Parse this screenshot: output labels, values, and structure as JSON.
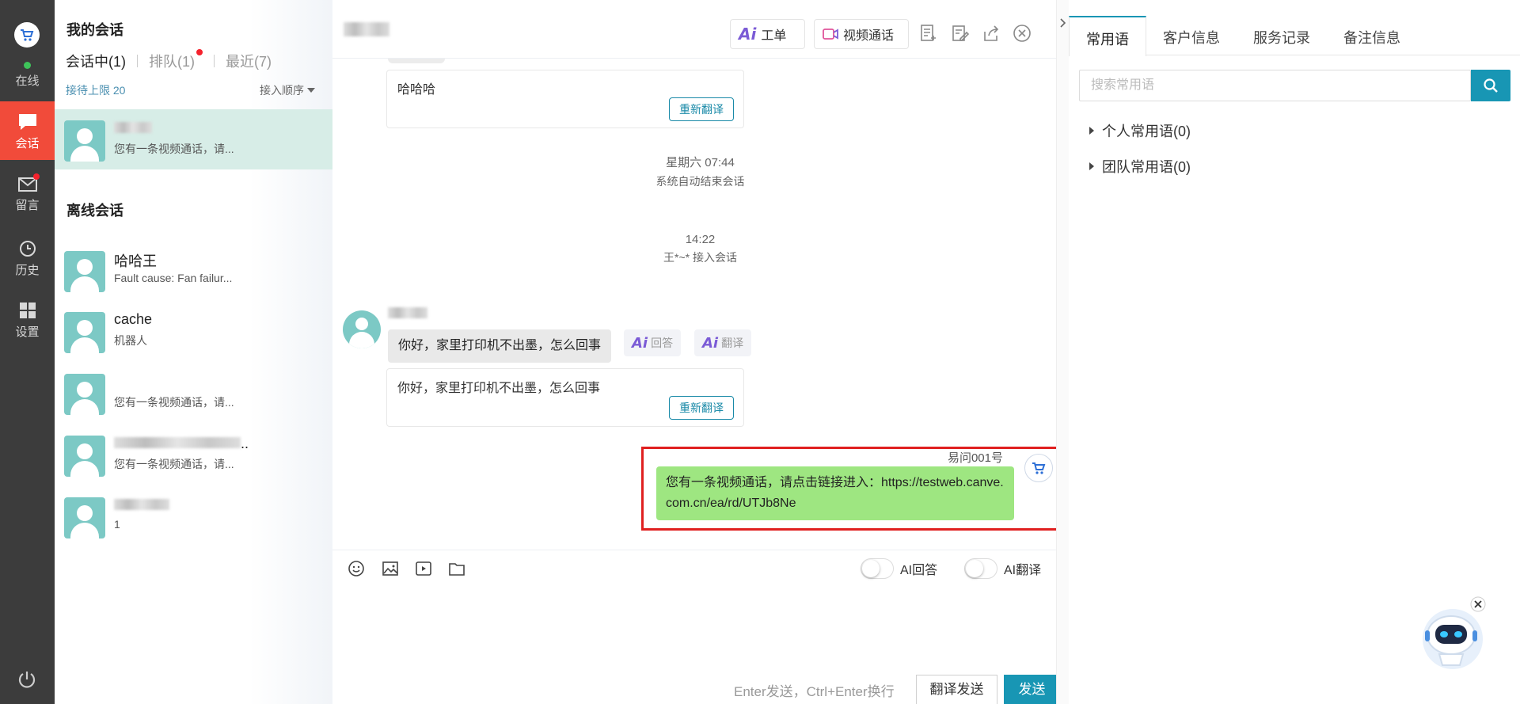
{
  "rail": {
    "status": "在线",
    "items": [
      {
        "label": "会话",
        "icon": "chat-icon"
      },
      {
        "label": "留言",
        "icon": "mail-icon"
      },
      {
        "label": "历史",
        "icon": "clock-icon"
      },
      {
        "label": "设置",
        "icon": "grid-icon"
      }
    ],
    "power_icon": "power-icon"
  },
  "sessions": {
    "title": "我的会话",
    "tabs": [
      {
        "label": "会话中(1)"
      },
      {
        "label": "排队(1)"
      },
      {
        "label": "最近(7)"
      }
    ],
    "limit": "接待上限 20",
    "order": "接入顺序",
    "active": [
      {
        "name": "",
        "preview": "您有一条视频通话，请..."
      }
    ],
    "offline_title": "离线会话",
    "offline": [
      {
        "name": "哈哈王",
        "preview": "Fault cause: Fan failur..."
      },
      {
        "name": "cache",
        "preview": "机器人"
      },
      {
        "name": "",
        "preview": "您有一条视频通话，请..."
      },
      {
        "name": "..",
        "preview": "您有一条视频通话，请..."
      },
      {
        "name": "",
        "preview": "1"
      }
    ]
  },
  "chat": {
    "header": {
      "ai_mark": "Ai",
      "ticket_label": "工单",
      "video_label": "视频通话"
    },
    "messages": {
      "translation_1": "哈哈哈",
      "retranslate": "重新翻译",
      "sys_1_time": "星期六 07:44",
      "sys_1_note": "系统自动结束会话",
      "sys_2_time": "14:22",
      "sys_2_note": "王*~* 接入会话",
      "customer_text": "你好，家里打印机不出墨，怎么回事",
      "ai_answer": "回答",
      "ai_translate": "翻译",
      "translation_2": "你好，家里打印机不出墨，怎么回事",
      "agent_name": "易问001号",
      "agent_text": "您有一条视频通话，请点击链接进入：https://testweb.canve.com.cn/ea/rd/UTJb8Ne"
    },
    "input": {
      "ai_reply_label": "AI回答",
      "ai_translate_label": "AI翻译",
      "hint": "Enter发送，Ctrl+Enter换行",
      "translate_send": "翻译发送",
      "send": "发送"
    }
  },
  "right": {
    "tabs": [
      "常用语",
      "客户信息",
      "服务记录",
      "备注信息"
    ],
    "search_placeholder": "搜索常用语",
    "groups": [
      "个人常用语(0)",
      "团队常用语(0)"
    ]
  },
  "colors": {
    "accent": "#1896b4",
    "rail_active": "#f14b3a",
    "agent_bubble": "#9ee681",
    "highlight_border": "#e02020"
  }
}
